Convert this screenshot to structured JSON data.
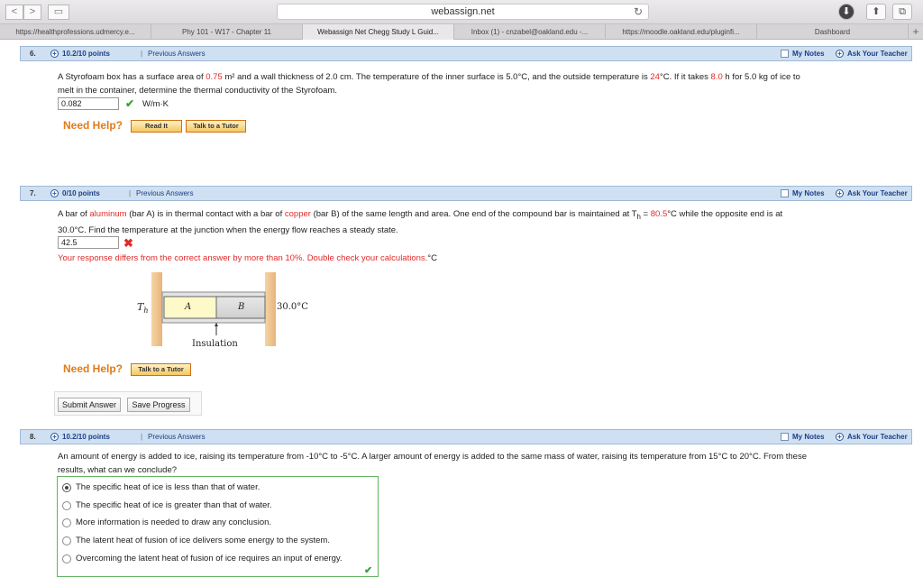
{
  "browser": {
    "back_glyph": "<",
    "forward_glyph": ">",
    "sidebar_glyph": "▭",
    "address": "webassign.net",
    "reload_glyph": "↻",
    "download_glyph": "⬇",
    "share_glyph": "⬆",
    "tabs_glyph": "⧉",
    "tabs": [
      {
        "label": "https://healthprofessions.udmercy.e..."
      },
      {
        "label": "Phy 101 - W17 - Chapter 11"
      },
      {
        "label": "Webassign Net Chegg Study L Guid..."
      },
      {
        "label": "Inbox (1) - cnzabel@oakland.edu -..."
      },
      {
        "label": "https://moodle.oakland.edu/pluginfi..."
      },
      {
        "label": "Dashboard"
      }
    ],
    "new_tab_glyph": "+"
  },
  "common": {
    "plus_glyph": "+",
    "separator": "|",
    "previous_answers": "Previous Answers",
    "my_notes": "My Notes",
    "ask_teacher": "Ask Your Teacher",
    "need_help": "Need Help?",
    "read_it": "Read It",
    "talk_tutor": "Talk to a Tutor",
    "check_glyph": "✔",
    "cross_glyph": "✖"
  },
  "q6": {
    "number": "6.",
    "points": "10.2/10 points",
    "line1_a": "A Styrofoam box has a surface area of ",
    "area": "0.75",
    "line1_b": " m² and a wall thickness of 2.0 cm. The temperature of the inner surface is 5.0°C, and the outside temperature is ",
    "temp_out": "24",
    "line1_c": "°C. If it takes ",
    "hours": "8.0",
    "line1_d": " h for 5.0 kg of ice to",
    "line2": "melt in the container, determine the thermal conductivity of the Styrofoam.",
    "answer": "0.082",
    "unit": "W/m·K"
  },
  "q7": {
    "number": "7.",
    "points": "0/10 points",
    "line1_a": "A bar of ",
    "metal1": "aluminum",
    "line1_b": " (bar A) is in thermal contact with a bar of ",
    "metal2": "copper",
    "line1_c": " (bar B) of the same length and area. One end of the compound bar is maintained at T",
    "th_sub": "h",
    "line1_d": " = ",
    "th_value": "80.5",
    "line1_e": "°C while the opposite end is at",
    "line2": "30.0°C. Find the temperature at the junction when the energy flow reaches a steady state.",
    "answer": "42.5",
    "feedback": "Your response differs from the correct answer by more than 10%. Double check your calculations.",
    "unit": "°C",
    "figure": {
      "th_label": "T",
      "th_sub": "h",
      "bar_a": "A",
      "bar_b": "B",
      "right_temp": "30.0°C",
      "insulation": "Insulation"
    },
    "submit": "Submit Answer",
    "save": "Save Progress"
  },
  "q8": {
    "number": "8.",
    "points": "10.2/10 points",
    "line1": "An amount of energy is added to ice, raising its temperature from -10°C to -5°C. A larger amount of energy is added to the same mass of water, raising its temperature from 15°C to 20°C. From these",
    "line2": "results, what can we conclude?",
    "options": [
      {
        "label": "The specific heat of ice is less than that of water.",
        "selected": true
      },
      {
        "label": "The specific heat of ice is greater than that of water.",
        "selected": false
      },
      {
        "label": "More information is needed to draw any conclusion.",
        "selected": false
      },
      {
        "label": "The latent heat of fusion of ice delivers some energy to the system.",
        "selected": false
      },
      {
        "label": "Overcoming the latent heat of fusion of ice requires an input of energy.",
        "selected": false
      }
    ]
  }
}
